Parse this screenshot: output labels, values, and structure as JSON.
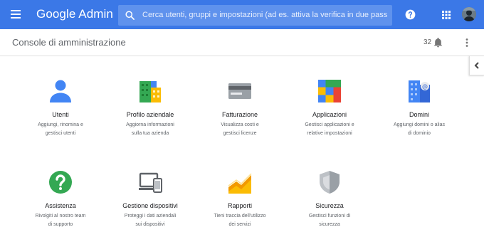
{
  "header": {
    "logo_text": "Google Admin",
    "search_placeholder": "Cerca utenti, gruppi e impostazioni (ad es. attiva la verifica in due pass",
    "icons": [
      "menu-icon",
      "search-icon",
      "help-icon",
      "apps-icon",
      "avatar"
    ],
    "brand_color": "#3b78e7"
  },
  "subheader": {
    "title": "Console di amministrazione",
    "notification_count": "32"
  },
  "cards": [
    {
      "title": "Utenti",
      "desc1": "Aggiungi, rinomina e",
      "desc2": "gestisci utenti",
      "icon": "users-icon"
    },
    {
      "title": "Profilo aziendale",
      "desc1": "Aggiorna informazioni",
      "desc2": "sulla tua azienda",
      "icon": "company-profile-icon"
    },
    {
      "title": "Fatturazione",
      "desc1": "Visualizza costi e",
      "desc2": "gestisci licenze",
      "icon": "billing-icon"
    },
    {
      "title": "Applicazioni",
      "desc1": "Gestisci applicazioni e",
      "desc2": "relative impostazioni",
      "icon": "apps-grid-icon"
    },
    {
      "title": "Domini",
      "desc1": "Aggiungi domini o alias",
      "desc2": "di dominio",
      "icon": "domains-icon"
    },
    {
      "title": "Assistenza",
      "desc1": "Rivolgiti al nostro team",
      "desc2": "di supporto",
      "icon": "support-icon"
    },
    {
      "title": "Gestione dispositivi",
      "desc1": "Proteggi i dati aziendali",
      "desc2": "sui dispositivi",
      "icon": "devices-icon"
    },
    {
      "title": "Rapporti",
      "desc1": "Tieni traccia dell'utilizzo",
      "desc2": "dei servizi",
      "icon": "reports-icon"
    },
    {
      "title": "Sicurezza",
      "desc1": "Gestisci funzioni di",
      "desc2": "sicurezza",
      "icon": "security-icon"
    }
  ]
}
